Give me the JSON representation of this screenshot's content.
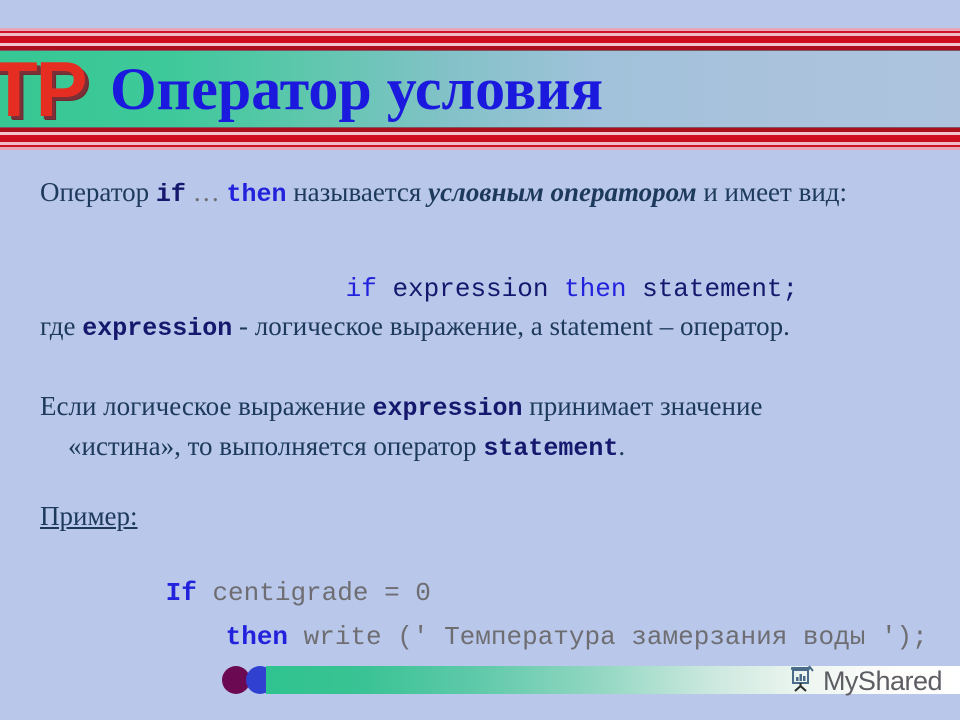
{
  "slide": {
    "background_color": "#b9c7ea",
    "banner": {
      "logo_text": "TP",
      "logo_color": "#e52d21",
      "title": "Оператор условия",
      "title_color": "#1a19dd",
      "gradient_from": "#36c793",
      "gradient_to": "#aec4de",
      "stripe_colors": [
        "#f2a8bc",
        "#cf0f22",
        "#e8808f",
        "#b60c1c",
        "#f4c3cf",
        "#a9101f"
      ]
    },
    "body": {
      "line_1": {
        "seg_1": "Оператор ",
        "seg_2_code": "if",
        "seg_3": "  …  ",
        "seg_4_code": "then",
        "seg_5": " называется ",
        "seg_6_italic": "условным оператором",
        "seg_7": " и имеет вид:"
      },
      "line_2_syntax": {
        "kw_if": "if",
        "expression": " expression ",
        "kw_then": "then",
        "statement": " statement;"
      },
      "line_3": {
        "seg_1": "где ",
        "seg_2_code": "expression",
        "seg_3": " - логическое выражение, a statement – оператор."
      },
      "line_4": {
        "seg_1": "Если логическое выражение ",
        "seg_2_code": "expression",
        "seg_3": " принимает значение",
        "seg_4": "«истина», то выполняется оператор ",
        "seg_5_code": "statement",
        "seg_6": "."
      },
      "example_label": "Пример:",
      "example_line_1": {
        "kw": "If",
        "rest": " centigrade = 0"
      },
      "example_line_2": {
        "kw": "then",
        "rest": " write (' Температура замерзания воды ');"
      }
    },
    "footer": {
      "brand": "MyShared",
      "brand_icon": "presentation-chart-icon",
      "dot_1_color": "#6b0a52",
      "dot_2_color": "#3040d0",
      "bar_gradient_from": "#2fc38f",
      "bar_gradient_to": "#ffffff"
    }
  }
}
